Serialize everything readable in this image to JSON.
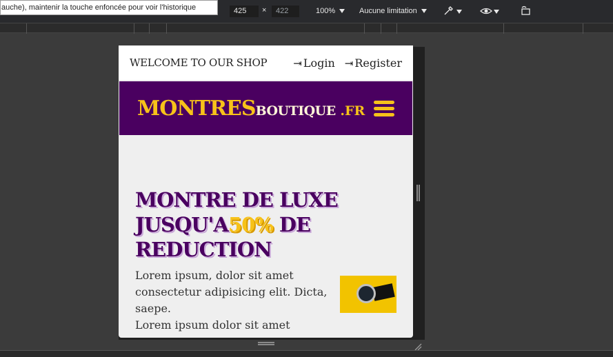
{
  "devtools": {
    "tooltip": "auche), maintenir la touche enfoncée pour voir l'historique",
    "width": "425",
    "height": "422",
    "times": "×",
    "zoom": "100%",
    "throttle": "Aucune limitation",
    "icons": [
      "eyedropper-icon",
      "eye-icon",
      "rotate-icon"
    ]
  },
  "site": {
    "welcome": "WELCOME TO OUR SHOP",
    "login": "Login",
    "register": "Register",
    "logo_main": "MONTRES",
    "logo_sub": "BOUTIQUE",
    "logo_tld": " .FR",
    "headline_1": "MONTRE DE LUXE",
    "headline_2a": "JUSQU'A",
    "headline_2b": "50%",
    "headline_2c": " DE",
    "headline_3": "REDUCTION",
    "body_1": "Lorem ipsum, dolor sit amet consectetur adipisicing elit. Dicta, saepe.",
    "body_2": "Lorem ipsum dolor sit amet consectetur"
  },
  "colors": {
    "brand_purple": "#4a0060",
    "brand_yellow": "#f7c21a"
  }
}
